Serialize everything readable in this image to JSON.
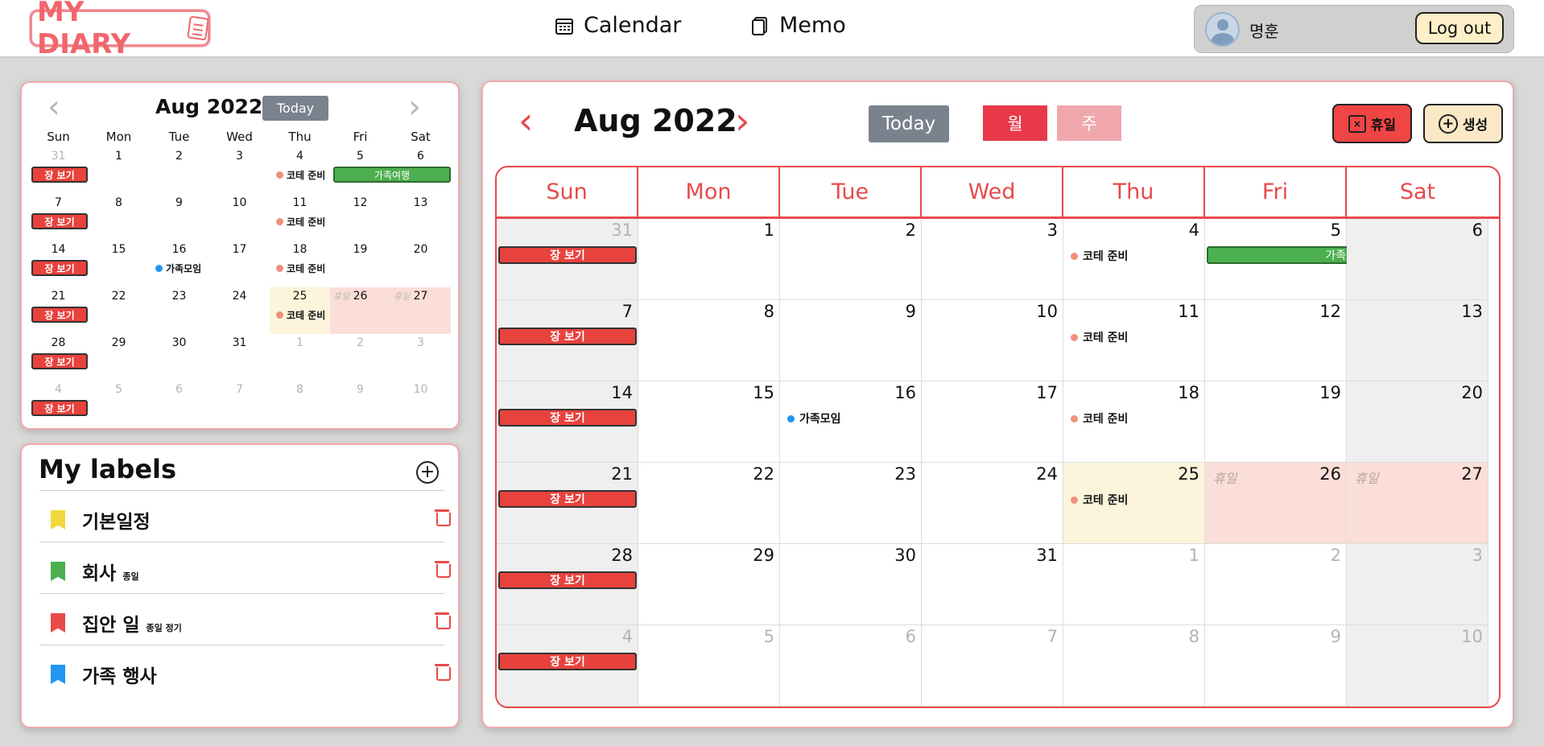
{
  "header": {
    "logo": "MY DIARY",
    "nav": [
      {
        "label": "Calendar",
        "icon": "calendar-icon"
      },
      {
        "label": "Memo",
        "icon": "memo-icon"
      }
    ],
    "user": {
      "name": "명훈",
      "logout": "Log out"
    }
  },
  "colors": {
    "accent": "#e84a4a",
    "event_red": "#e8423d",
    "trip_green": "#4caf50",
    "today_bg": "#fcf5dc",
    "holiday_bg": "#fbded8"
  },
  "mini": {
    "title": "Aug 2022",
    "today": "Today",
    "dow": [
      "Sun",
      "Mon",
      "Tue",
      "Wed",
      "Thu",
      "Fri",
      "Sat"
    ],
    "weeks": [
      [
        "31",
        "1",
        "2",
        "3",
        "4",
        "5",
        "6"
      ],
      [
        "7",
        "8",
        "9",
        "10",
        "11",
        "12",
        "13"
      ],
      [
        "14",
        "15",
        "16",
        "17",
        "18",
        "19",
        "20"
      ],
      [
        "21",
        "22",
        "23",
        "24",
        "25",
        "26",
        "27"
      ],
      [
        "28",
        "29",
        "30",
        "31",
        "1",
        "2",
        "3"
      ],
      [
        "4",
        "5",
        "6",
        "7",
        "8",
        "9",
        "10"
      ]
    ]
  },
  "events": {
    "shopping": "장 보기",
    "coding_test": "코테 준비",
    "family_trip": "가족여행",
    "family_meetup": "가족모임",
    "holiday": "휴일"
  },
  "labels": {
    "title": "My labels",
    "items": [
      {
        "name": "기본일정",
        "tags": "",
        "color": "#f2d83a"
      },
      {
        "name": "회사",
        "tags": "종일",
        "color": "#4caf50"
      },
      {
        "name": "집안 일",
        "tags": "종일  정기",
        "color": "#e84a4a"
      },
      {
        "name": "가족 행사",
        "tags": "",
        "color": "#2196f3"
      }
    ]
  },
  "main": {
    "title": "Aug 2022",
    "today": "Today",
    "view_month": "월",
    "view_week": "주",
    "holiday_btn": "휴일",
    "create_btn": "생성",
    "dow": [
      "Sun",
      "Mon",
      "Tue",
      "Wed",
      "Thu",
      "Fri",
      "Sat"
    ],
    "weeks": [
      [
        "31",
        "1",
        "2",
        "3",
        "4",
        "5",
        "6"
      ],
      [
        "7",
        "8",
        "9",
        "10",
        "11",
        "12",
        "13"
      ],
      [
        "14",
        "15",
        "16",
        "17",
        "18",
        "19",
        "20"
      ],
      [
        "21",
        "22",
        "23",
        "24",
        "25",
        "26",
        "27"
      ],
      [
        "28",
        "29",
        "30",
        "31",
        "1",
        "2",
        "3"
      ],
      [
        "4",
        "5",
        "6",
        "7",
        "8",
        "9",
        "10"
      ]
    ]
  }
}
